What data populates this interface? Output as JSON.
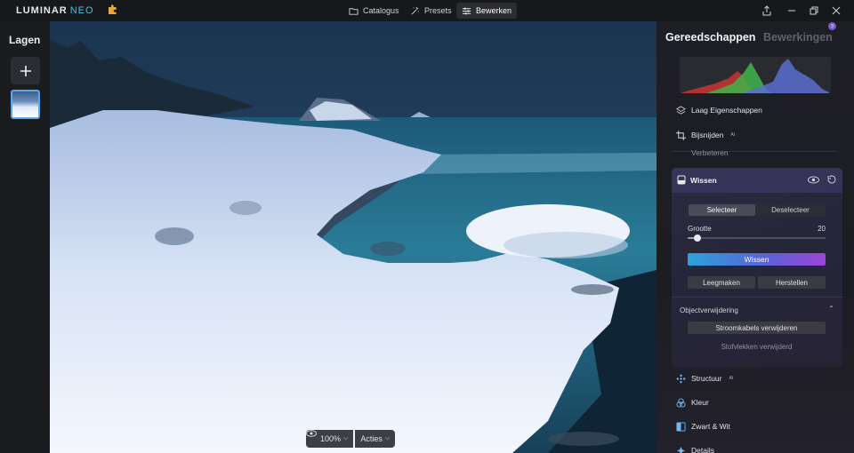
{
  "app": {
    "name": "LUMINAR",
    "name_suffix": "NEO"
  },
  "nav": {
    "catalogus": "Catalogus",
    "presets": "Presets",
    "bewerken": "Bewerken"
  },
  "layers": {
    "title": "Lagen"
  },
  "canvas": {
    "zoom": "100%",
    "acties": "Acties"
  },
  "right": {
    "tab_tools": "Gereedschappen",
    "tab_edits": "Bewerkingen",
    "edits_badge": "3",
    "items": {
      "laag": "Laag Eigenschappen",
      "bijsnijden": "Bijsnijden",
      "verbeteren": "Verbeteren",
      "structuur": "Structuur",
      "kleur": "Kleur",
      "zwart_wit": "Zwart & Wit",
      "details": "Details"
    },
    "ai_tag": "AI",
    "wissen": {
      "title": "Wissen",
      "selecteer": "Selecteer",
      "deselecteer": "Deselecteer",
      "grootte_label": "Grootte",
      "grootte_value": "20",
      "grootte_fraction": 0.07,
      "wissen_button": "Wissen",
      "leegmaken": "Leegmaken",
      "herstellen": "Herstellen",
      "section": "Objectverwijdering",
      "stroomkabels": "Stroomkabels verwijderen",
      "stofvlekken": "Stofvlekken verwijderd"
    }
  },
  "colors": {
    "accent_blue": "#2aa3d8",
    "accent_purple": "#9a45d8",
    "selection_border": "#5fa7e6"
  }
}
